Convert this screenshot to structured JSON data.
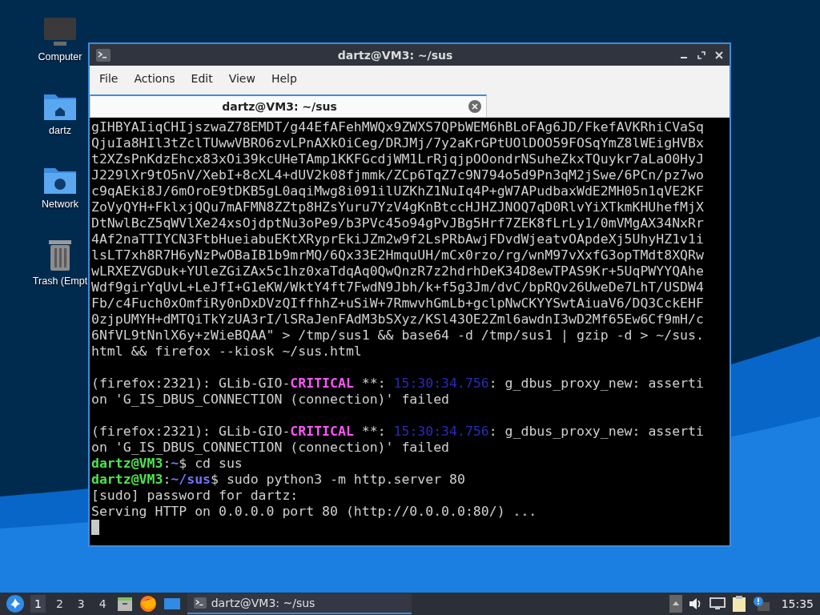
{
  "desktop_icons": [
    {
      "label": "Computer",
      "kind": "computer"
    },
    {
      "label": "dartz",
      "kind": "home"
    },
    {
      "label": "Network",
      "kind": "network"
    },
    {
      "label": "Trash (Empt",
      "kind": "trash"
    }
  ],
  "window": {
    "title": "dartz@VM3: ~/sus",
    "menu": [
      "File",
      "Actions",
      "Edit",
      "View",
      "Help"
    ],
    "tabs": [
      {
        "label": "dartz@VM3: ~/sus",
        "selected": true
      }
    ],
    "terminal_lines": [
      {
        "kind": "line",
        "segments": [
          {
            "kind": "text",
            "text": "gIHBYAIiqCHIjszwaZ78EMDT/g44EfAFehMWQx9ZWXS7QPbWEM6hBLoFAg6JD/FkefAVKRhiCVaSq"
          }
        ]
      },
      {
        "kind": "line",
        "segments": [
          {
            "kind": "text",
            "text": "QjuIa8HIl3tZclTUwwVBRO6zvLPnAXkOiCeg/DRJMj/7y2aKrGPtUOlDOO59FOSqYmZ8lWEigHVBx"
          }
        ]
      },
      {
        "kind": "line",
        "segments": [
          {
            "kind": "text",
            "text": "t2XZsPnKdzEhcx83xOi39kcUHeTAmp1KKFGcdjWM1LrRjqjpOOondrNSuheZkxTQuykr7aLaO0HyJ"
          }
        ]
      },
      {
        "kind": "line",
        "segments": [
          {
            "kind": "text",
            "text": "J229lXr9tO5nV/XebI+8cXL4+dUV2k08fjmmk/ZCp6TqZ7c9N794o5d9Pn3qM2jSwe/6PCn/pz7wo"
          }
        ]
      },
      {
        "kind": "line",
        "segments": [
          {
            "kind": "text",
            "text": "c9qAEki8J/6mOroE9tDKB5gL0aqiMwg8i091ilUZKhZ1NuIq4P+gW7APudbaxWdE2MH05n1qVE2KF"
          }
        ]
      },
      {
        "kind": "line",
        "segments": [
          {
            "kind": "text",
            "text": "ZoVyQYH+FklxjQQu7mAFMN8ZZtp8HZsYuru7YzV4gKnBtccHJHZJNOQ7qD0RlvYiXTkmKHUhefMjX"
          }
        ]
      },
      {
        "kind": "line",
        "segments": [
          {
            "kind": "text",
            "text": "DtNwlBcZ5qWVlXe24xsOjdptNu3oPe9/b3PVc45o94gPvJBg5Hrf7ZEK8fLrLy1/0mVMgAX34NxRr"
          }
        ]
      },
      {
        "kind": "line",
        "segments": [
          {
            "kind": "text",
            "text": "4Af2naTTIYCN3FtbHueiabuEKtXRyprEkiJZm2w9f2LsPRbAwjFDvdWjeatvOApdeXj5UhyHZ1v1i"
          }
        ]
      },
      {
        "kind": "line",
        "segments": [
          {
            "kind": "text",
            "text": "lsLT7xh8R7H6yNzPwOBaIB1b9mrMQ/6Qx33E2HmquUH/mCx0rzo/rg/wnM97vXxfG3opTMdt8XQRw"
          }
        ]
      },
      {
        "kind": "line",
        "segments": [
          {
            "kind": "text",
            "text": "wLRXEZVGDuk+YUleZGiZAx5c1hz0xaTdqAq0QwQnzR7z2hdrhDeK34D8ewTPAS9Kr+5UqPWYYQAhe"
          }
        ]
      },
      {
        "kind": "line",
        "segments": [
          {
            "kind": "text",
            "text": "Wdf9girYqUvL+LeJfI+G1eKW/WktY4ft7FwdN9Jbh/k+f5g3Jm/dvC/bpRQv26UweDe7LhT/USDW4"
          }
        ]
      },
      {
        "kind": "line",
        "segments": [
          {
            "kind": "text",
            "text": "Fb/c4Fuch0xOmfiRy0nDxDVzQIffhhZ+uSiW+7RmwvhGmLb+gclpNwCKYYSwtAiuaV6/DQ3CckEHF"
          }
        ]
      },
      {
        "kind": "line",
        "segments": [
          {
            "kind": "text",
            "text": "0zjpUMYH+dMTQiTkYzUA3rI/lSRaJenFAdM3bSXyz/KSl43OE2Zml6awdnI3wD2Mf65Ew6Cf9mH/c"
          }
        ]
      },
      {
        "kind": "line",
        "segments": [
          {
            "kind": "text",
            "text": "6NfVL9tNnlX6y+zWieBQAA\" > /tmp/sus1 && base64 -d /tmp/sus1 | gzip -d > ~/sus."
          }
        ]
      },
      {
        "kind": "line",
        "segments": [
          {
            "kind": "text",
            "text": "html && firefox --kiosk ~/sus.html"
          }
        ]
      },
      {
        "kind": "blank"
      },
      {
        "kind": "line",
        "segments": [
          {
            "kind": "text",
            "text": "(firefox:2321): GLib-GIO-"
          },
          {
            "kind": "critical",
            "text": "CRITICAL"
          },
          {
            "kind": "text",
            "text": " **: "
          },
          {
            "kind": "timestamp",
            "text": "15:30:34.756"
          },
          {
            "kind": "text",
            "text": ": g_dbus_proxy_new: asserti"
          }
        ]
      },
      {
        "kind": "line",
        "segments": [
          {
            "kind": "text",
            "text": "on 'G_IS_DBUS_CONNECTION (connection)' failed"
          }
        ]
      },
      {
        "kind": "blank"
      },
      {
        "kind": "line",
        "segments": [
          {
            "kind": "text",
            "text": "(firefox:2321): GLib-GIO-"
          },
          {
            "kind": "critical",
            "text": "CRITICAL"
          },
          {
            "kind": "text",
            "text": " **: "
          },
          {
            "kind": "timestamp",
            "text": "15:30:34.756"
          },
          {
            "kind": "text",
            "text": ": g_dbus_proxy_new: asserti"
          }
        ]
      },
      {
        "kind": "line",
        "segments": [
          {
            "kind": "text",
            "text": "on 'G_IS_DBUS_CONNECTION (connection)' failed"
          }
        ]
      },
      {
        "kind": "line",
        "segments": [
          {
            "kind": "user",
            "text": "dartz@VM3"
          },
          {
            "kind": "text",
            "text": ":"
          },
          {
            "kind": "path",
            "text": "~"
          },
          {
            "kind": "text",
            "text": "$ cd sus"
          }
        ]
      },
      {
        "kind": "line",
        "segments": [
          {
            "kind": "user",
            "text": "dartz@VM3"
          },
          {
            "kind": "text",
            "text": ":"
          },
          {
            "kind": "path",
            "text": "~/sus"
          },
          {
            "kind": "text",
            "text": "$ sudo python3 -m http.server 80"
          }
        ]
      },
      {
        "kind": "line",
        "segments": [
          {
            "kind": "text",
            "text": "[sudo] password for dartz:"
          }
        ]
      },
      {
        "kind": "line",
        "segments": [
          {
            "kind": "text",
            "text": "Serving HTTP on 0.0.0.0 port 80 (http://0.0.0.0:80/) ..."
          }
        ]
      },
      {
        "kind": "cursor"
      }
    ]
  },
  "taskbar": {
    "workspaces": [
      {
        "label": "1",
        "selected": true
      },
      {
        "label": "2",
        "selected": false
      },
      {
        "label": "3",
        "selected": false
      },
      {
        "label": "4",
        "selected": false
      }
    ],
    "launchers": [
      {
        "kind": "files"
      },
      {
        "kind": "browser"
      },
      {
        "kind": "desktop"
      }
    ],
    "tasks": [
      {
        "label": "dartz@VM3: ~/sus",
        "selected": true
      }
    ],
    "tray": [
      {
        "kind": "arrow"
      },
      {
        "kind": "volume"
      },
      {
        "kind": "network"
      },
      {
        "kind": "clipboard"
      },
      {
        "kind": "notification"
      }
    ],
    "clock": "15:35"
  }
}
